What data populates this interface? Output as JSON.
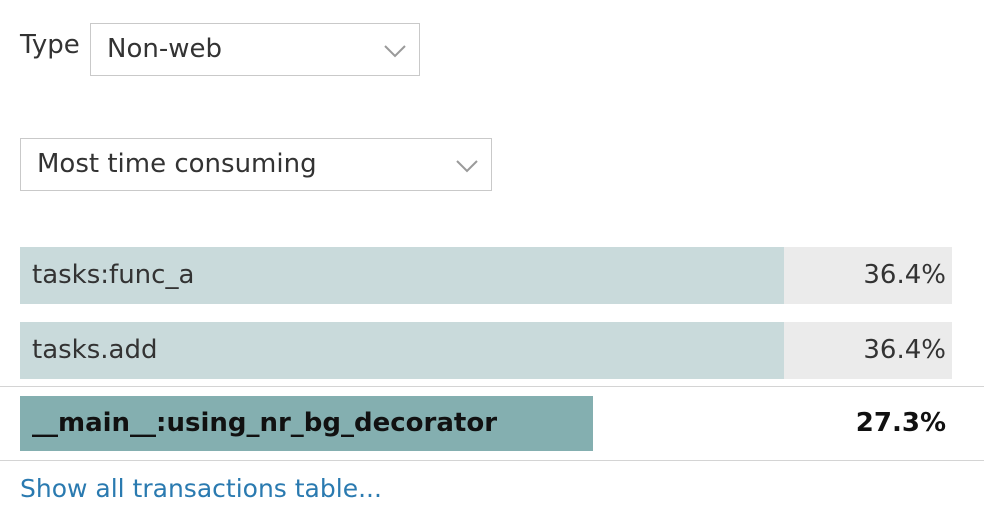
{
  "filter": {
    "type_label": "Type",
    "type_value": "Non-web",
    "sort_value": "Most time consuming"
  },
  "transactions": [
    {
      "name": "tasks:func_a",
      "percent_label": "36.4%",
      "percent": 36.4,
      "fill_fraction": 0.82,
      "selected": false
    },
    {
      "name": "tasks.add",
      "percent_label": "36.4%",
      "percent": 36.4,
      "fill_fraction": 0.82,
      "selected": false
    },
    {
      "name": "__main__:using_nr_bg_decorator",
      "percent_label": "27.3%",
      "percent": 27.3,
      "fill_fraction": 0.615,
      "selected": true
    }
  ],
  "footer": {
    "show_all_label": "Show all transactions table..."
  },
  "colors": {
    "bar_fill": "#c9dadb",
    "bar_fill_selected": "#84afb0",
    "bar_track": "#ebebeb",
    "link": "#2a7ab0"
  },
  "icons": {
    "dropdown": "chevron-down-icon"
  }
}
